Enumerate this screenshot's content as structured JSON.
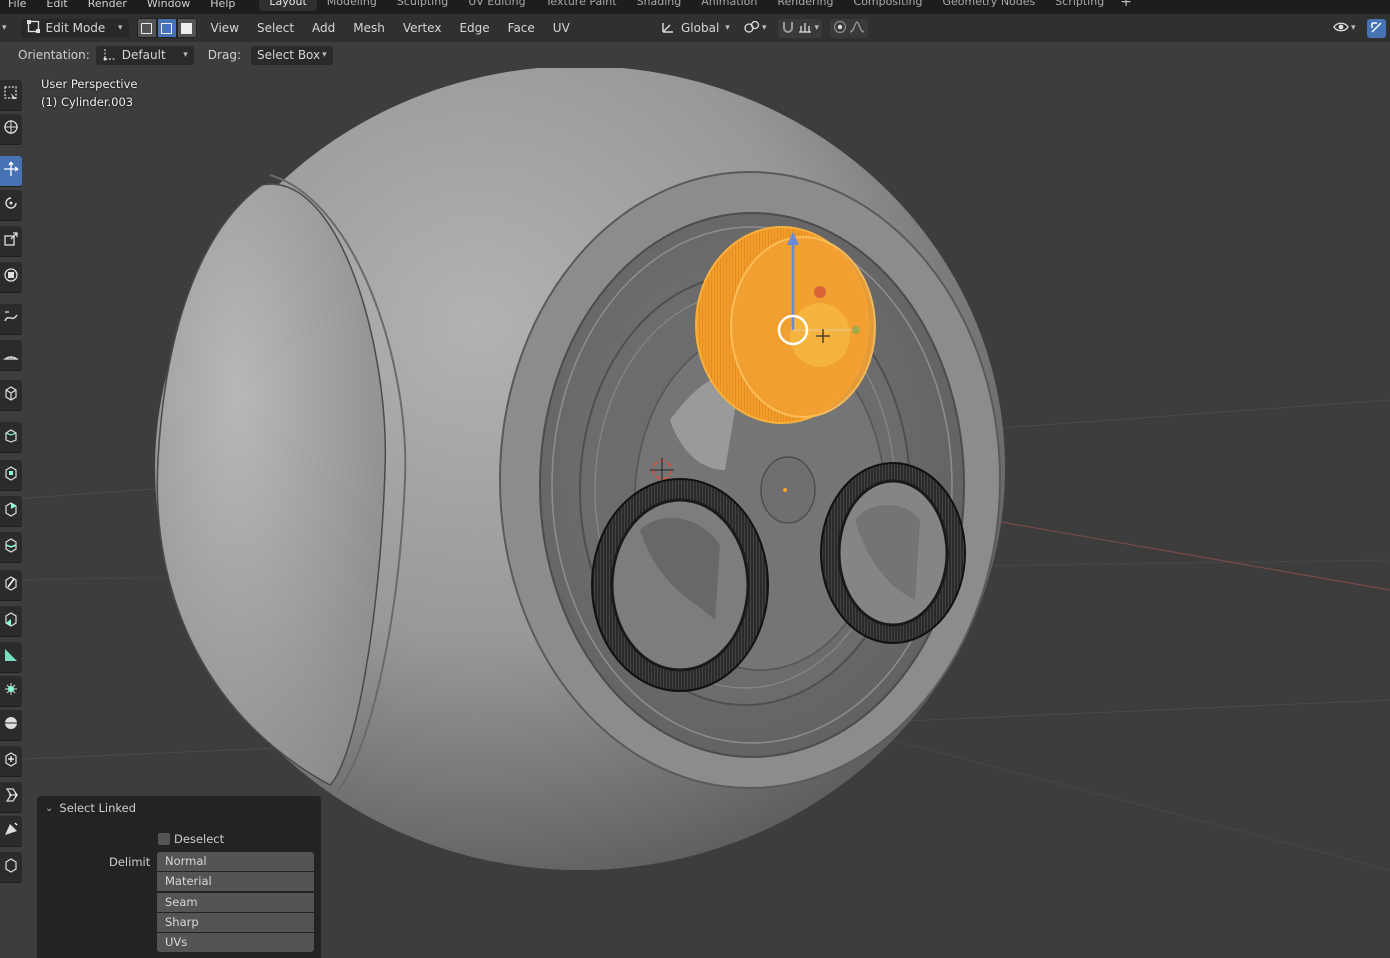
{
  "top_menu": [
    "File",
    "Edit",
    "Render",
    "Window",
    "Help"
  ],
  "workspace_tabs": [
    {
      "label": "Layout",
      "active": true
    },
    {
      "label": "Modeling"
    },
    {
      "label": "Sculpting"
    },
    {
      "label": "UV Editing"
    },
    {
      "label": "Texture Paint"
    },
    {
      "label": "Shading"
    },
    {
      "label": "Animation"
    },
    {
      "label": "Rendering"
    },
    {
      "label": "Compositing"
    },
    {
      "label": "Geometry Nodes"
    },
    {
      "label": "Scripting"
    }
  ],
  "add_workspace_icon": "+",
  "header": {
    "mode": "Edit Mode",
    "menus": [
      "View",
      "Select",
      "Add",
      "Mesh",
      "Vertex",
      "Edge",
      "Face",
      "UV"
    ],
    "transform_orientation": "Global"
  },
  "tool_settings": {
    "orientation_label": "Orientation:",
    "orientation_value": "Default",
    "drag_label": "Drag:",
    "drag_value": "Select Box"
  },
  "viewport": {
    "view_name": "User Perspective",
    "object_name": "(1) Cylinder.003",
    "selection_color": "#f5a22e",
    "background_color": "#3d3d3d"
  },
  "toolbar_icons": [
    "select-box-icon",
    "cursor-icon",
    "move-icon",
    "rotate-icon",
    "scale-icon",
    "transform-icon",
    "annotate-icon",
    "measure-icon",
    "add-cube-icon",
    "extrude-icon",
    "inset-icon",
    "bevel-icon",
    "loop-cut-icon",
    "knife-icon",
    "poly-build-icon",
    "spin-icon",
    "smooth-icon",
    "edge-slide-icon",
    "shrink-fatten-icon",
    "shear-icon",
    "rip-icon"
  ],
  "operator_panel": {
    "title": "Select Linked",
    "deselect_label": "Deselect",
    "delimit_label": "Delimit",
    "delimit_options": [
      "Normal",
      "Material",
      "Seam",
      "Sharp",
      "UVs"
    ]
  }
}
